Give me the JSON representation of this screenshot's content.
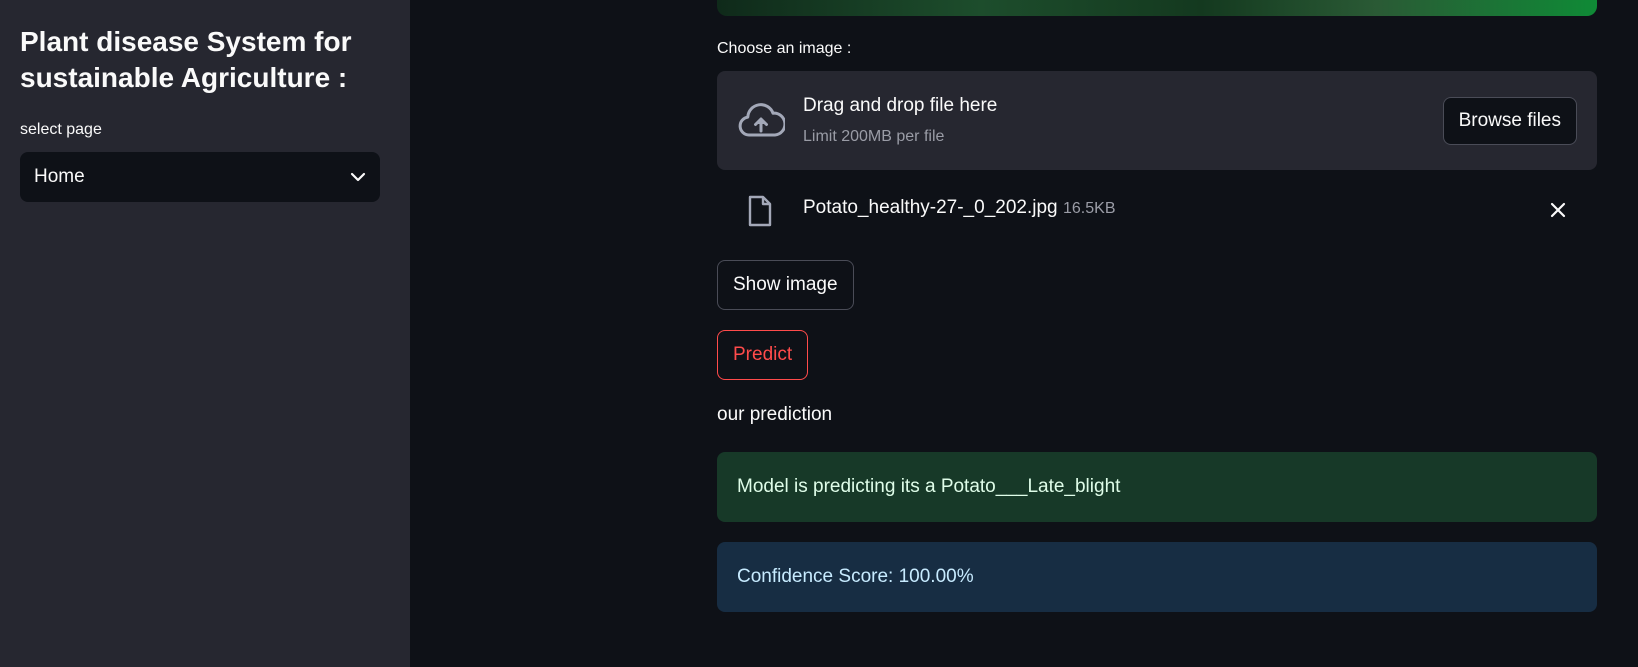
{
  "sidebar": {
    "title": "Plant disease System for sustainable Agriculture :",
    "select_label": "select page",
    "select_value": "Home"
  },
  "uploader": {
    "label": "Choose an image :",
    "drop_title": "Drag and drop file here",
    "drop_subtitle": "Limit 200MB per file",
    "browse_label": "Browse files",
    "file_name": "Potato_healthy-27-_0_202.jpg",
    "file_size": "16.5KB"
  },
  "actions": {
    "show_image_label": "Show image",
    "predict_label": "Predict"
  },
  "result": {
    "heading": "our prediction",
    "prediction_text": "Model is predicting its a Potato___Late_blight",
    "confidence_text": "Confidence Score: 100.00%"
  },
  "colors": {
    "background": "#0e1117",
    "sidebar": "#262730",
    "accent": "#ff4b4b",
    "success_bg": "#173928",
    "info_bg": "#172d43"
  },
  "icons": {
    "dropzone": "cloud-upload-icon",
    "file": "file-icon",
    "remove": "close-icon",
    "select": "chevron-down-icon"
  }
}
